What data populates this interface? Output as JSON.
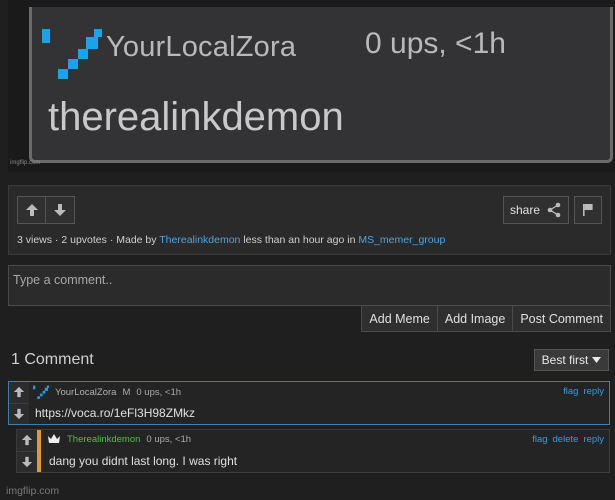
{
  "meme": {
    "username": "YourLocalZora",
    "ups": "0 ups, <1h",
    "caption": "therealinkdemon",
    "watermark": "imgflip.com"
  },
  "panel": {
    "share_label": "share",
    "views": "3 views",
    "upvotes": "2 upvotes",
    "made_by_prefix": "Made by",
    "author": "Therealinkdemon",
    "time_text": "less than an hour ago in",
    "group": "MS_memer_group"
  },
  "comment_form": {
    "placeholder": "Type a comment..",
    "add_meme": "Add Meme",
    "add_image": "Add Image",
    "post_comment": "Post Comment"
  },
  "comments_header": {
    "count": "1 Comment",
    "sort_label": "Best first"
  },
  "comments": [
    {
      "username": "YourLocalZora",
      "badge": "M",
      "ups": "0 ups, <1h",
      "text": "https://voca.ro/1eFl3H98ZMkz",
      "links": [
        "flag",
        "reply"
      ]
    },
    {
      "username": "Therealinkdemon",
      "ups": "0 ups, <1h",
      "text": "dang you didnt last long. I was right",
      "links": [
        "flag",
        "delete",
        "reply"
      ]
    }
  ],
  "footer": "imgflip.com",
  "colors": {
    "link": "#4fa3e0",
    "green_user": "#4fbf4f",
    "orange_bar": "#e39a2a",
    "logo_blue": "#1aa3e8"
  }
}
